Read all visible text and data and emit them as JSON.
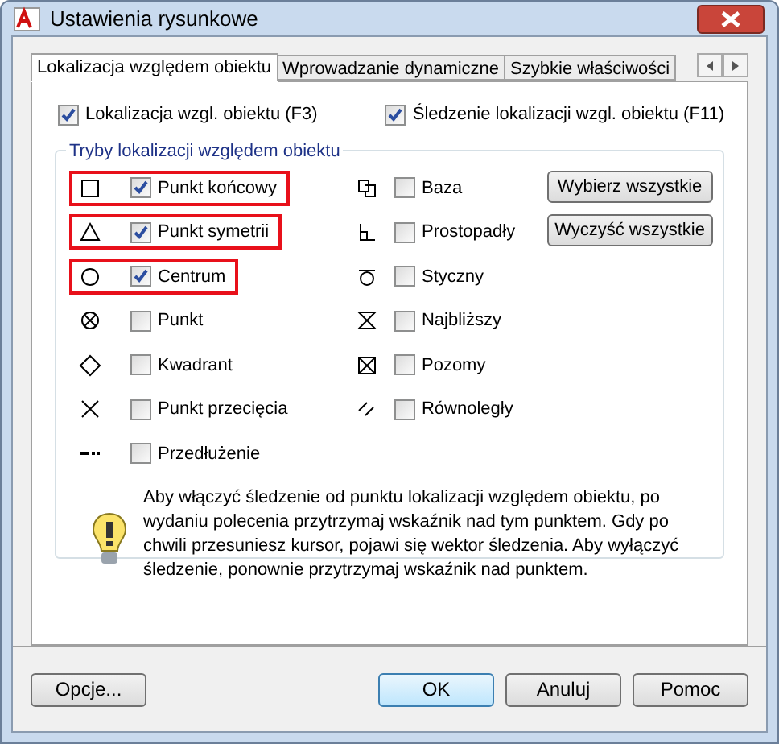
{
  "window": {
    "title": "Ustawienia rysunkowe"
  },
  "tabs": [
    {
      "label": "Lokalizacja względem obiektu",
      "selected": true
    },
    {
      "label": "Wprowadzanie dynamiczne",
      "selected": false
    },
    {
      "label": "Szybkie właściwości",
      "selected": false
    }
  ],
  "top_options": [
    {
      "label": "Lokalizacja wzgl. obiektu (F3)",
      "checked": true
    },
    {
      "label": "Śledzenie lokalizacji wzgl. obiektu (F11)",
      "checked": true
    }
  ],
  "group": {
    "title": "Tryby lokalizacji względem obiektu",
    "left_modes": [
      {
        "kind": "square",
        "label": "Punkt końcowy",
        "checked": true,
        "highlighted": true
      },
      {
        "kind": "triangle",
        "label": "Punkt symetrii",
        "checked": true,
        "highlighted": true
      },
      {
        "kind": "circle",
        "label": "Centrum",
        "checked": true,
        "highlighted": true
      },
      {
        "kind": "node",
        "label": "Punkt",
        "checked": false,
        "highlighted": false
      },
      {
        "kind": "diamond",
        "label": "Kwadrant",
        "checked": false,
        "highlighted": false
      },
      {
        "kind": "cross",
        "label": "Punkt przecięcia",
        "checked": false,
        "highlighted": false
      },
      {
        "kind": "extension",
        "label": "Przedłużenie",
        "checked": false,
        "highlighted": false
      }
    ],
    "right_modes": [
      {
        "kind": "base",
        "label": "Baza",
        "checked": false,
        "highlighted": false
      },
      {
        "kind": "perpendicular",
        "label": "Prostopadły",
        "checked": false,
        "highlighted": false
      },
      {
        "kind": "tangent",
        "label": "Styczny",
        "checked": false,
        "highlighted": false
      },
      {
        "kind": "nearest",
        "label": "Najbliższy",
        "checked": false,
        "highlighted": false
      },
      {
        "kind": "boxcross",
        "label": "Pozomy",
        "checked": false,
        "highlighted": false
      },
      {
        "kind": "parallel",
        "label": "Równoległy",
        "checked": false,
        "highlighted": false
      }
    ],
    "buttons": [
      "Wybierz wszystkie",
      "Wyczyść wszystkie"
    ],
    "note": "Aby włączyć śledzenie od punktu lokalizacji względem obiektu, po wydaniu polecenia przytrzymaj wskaźnik nad tym punktem. Gdy po chwili przesuniesz kursor, pojawi się wektor śledzenia. Aby wyłączyć śledzenie, ponownie przytrzymaj wskaźnik nad punktem."
  },
  "footer_buttons": [
    {
      "label": "Opcje...",
      "default": false
    },
    {
      "label": "OK",
      "default": true
    },
    {
      "label": "Anuluj",
      "default": false
    },
    {
      "label": "Pomoc",
      "default": false
    }
  ]
}
